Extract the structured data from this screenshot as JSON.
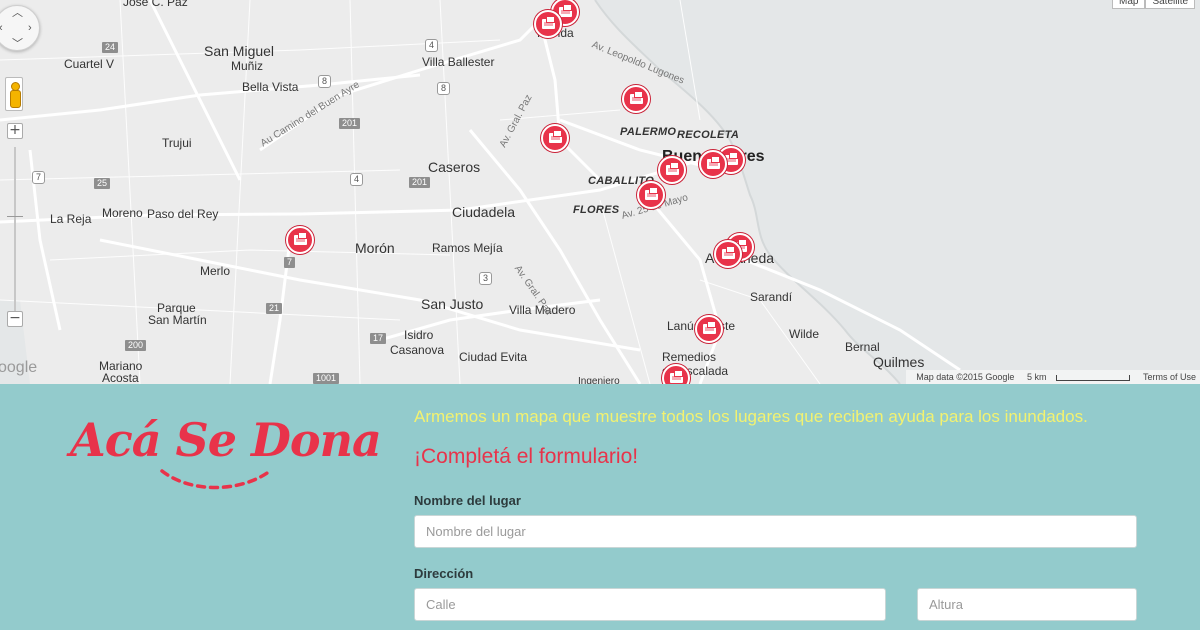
{
  "map": {
    "labels": {
      "jose_c_paz": "José C. Paz",
      "cuartel_v": "Cuartel V",
      "san_miguel": "San Miguel",
      "muniz": "Muñiz",
      "bella_vista": "Bella Vista",
      "villa_ballester": "Villa Ballester",
      "florida": "Florida",
      "trujui": "Trujui",
      "caseros": "Caseros",
      "palermo": "PALERMO",
      "recoleta": "RECOLETA",
      "buenos_aires": "Buenos Aires",
      "caballito": "CABALLITO",
      "flores": "FLORES",
      "la_reja": "La Reja",
      "moreno": "Moreno",
      "paso_del_rey": "Paso del Rey",
      "ciudadela": "Ciudadela",
      "moron": "Morón",
      "ramos_mejia": "Ramos Mejía",
      "merlo": "Merlo",
      "avellaneda": "Avellaneda",
      "sarandi": "Sarandí",
      "san_justo": "San Justo",
      "villa_madero": "Villa Madero",
      "parque_san_martin_1": "Parque",
      "parque_san_martin_2": "San Martín",
      "lanus_oeste": "Lanús Oeste",
      "wilde": "Wilde",
      "bernal": "Bernal",
      "isidro_1": "Isidro",
      "isidro_2": "Casanova",
      "ciudad_evita": "Ciudad Evita",
      "remedios_1": "Remedios",
      "remedios_2": "de Escalada",
      "quilmes": "Quilmes",
      "mariano_1": "Mariano",
      "mariano_2": "Acosta",
      "ingeniero": "Ingeniero",
      "road_buen_ayre": "Au Camino del Buen Ayre",
      "road_gral_paz_1": "Av. Gral. Paz",
      "road_gral_paz_2": "Av. Gral. Paz",
      "road_lugones": "Av. Leopoldo Lugones",
      "road_mayo": "Av. 25 de Mayo"
    },
    "routes": {
      "r24": "24",
      "r4a": "4",
      "r8": "8",
      "r8b": "8",
      "r201a": "201",
      "r7a": "7",
      "r25": "25",
      "r4b": "4",
      "r201b": "201",
      "r7b": "7",
      "r3": "3",
      "r21": "21",
      "r200": "200",
      "r17": "17",
      "r1001": "1001"
    },
    "map_type": {
      "map": "Map",
      "satellite": "Satellite"
    },
    "attribution": {
      "data": "Map data ©2015 Google",
      "scale": "5 km",
      "terms": "Terms of Use"
    },
    "google_logo": "oogle",
    "marker_icon": "donation-box-icon",
    "marker_color": "#e8334a"
  },
  "brand": {
    "logo_text": "Acá Se Dona",
    "primary_color": "#e8334a",
    "panel_color": "#93cbcc",
    "intro_color": "#f3f270"
  },
  "form": {
    "intro": "Armemos un mapa que muestre todos los lugares que reciben ayuda para los inundados.",
    "cta": "¡Completá el formulario!",
    "place_label": "Nombre del lugar",
    "place_placeholder": "Nombre del lugar",
    "address_label": "Dirección",
    "street_placeholder": "Calle",
    "number_placeholder": "Altura"
  }
}
